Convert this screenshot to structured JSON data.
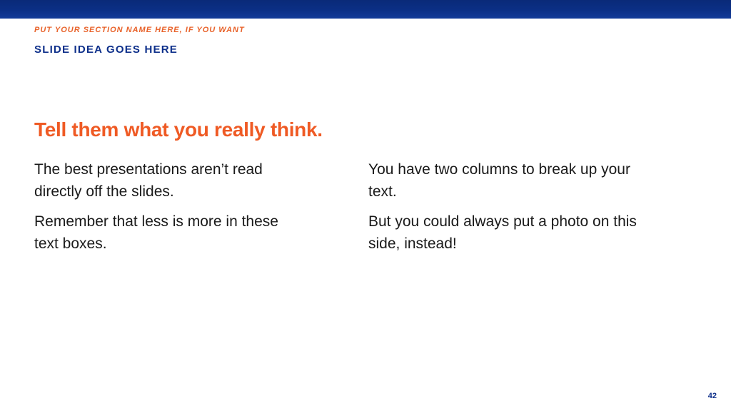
{
  "header": {
    "section_name": "PUT YOUR SECTION NAME HERE, IF YOU WANT",
    "slide_idea": "SLIDE IDEA GOES HERE"
  },
  "main": {
    "headline": "Tell them what you really think.",
    "left_column": {
      "paragraphs": [
        "The best presentations aren’t read directly off the slides.",
        "Remember that less is more in these text boxes."
      ]
    },
    "right_column": {
      "paragraphs": [
        "You have two columns to break up your text.",
        "But you could always put a photo on this side, instead!"
      ]
    }
  },
  "footer": {
    "page_number": "42"
  },
  "colors": {
    "top_bar": "#0b2f86",
    "section_name": "#e8622a",
    "slide_idea": "#0d2f8a",
    "headline": "#ef5a24",
    "body_text": "#1a1a1a"
  }
}
